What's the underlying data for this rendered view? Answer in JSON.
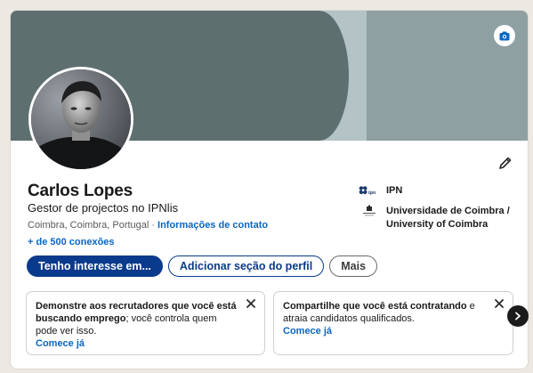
{
  "profile": {
    "name": "Carlos Lopes",
    "headline": "Gestor de projectos no IPNlis",
    "location": "Coimbra, Coimbra, Portugal",
    "separator": "·",
    "contact_link": "Informações de contato",
    "connections": "+ de 500 conexões"
  },
  "right_list": [
    {
      "logo": "ipn-logo",
      "label": "IPN"
    },
    {
      "logo": "university-coimbra-logo",
      "label": "Universidade de Coimbra / University of Coimbra"
    }
  ],
  "actions": {
    "primary": "Tenho interesse em...",
    "add_section": "Adicionar seção do perfil",
    "more": "Mais"
  },
  "tips": [
    {
      "bold_text": "Demonstre aos recrutadores que você está buscando emprego",
      "rest_text": "; você controla quem pode ver isso.",
      "link": "Comece já"
    },
    {
      "bold_text": "Compartilhe que você está contratando",
      "rest_text": " e atraia candidatos qualificados.",
      "link": "Comece já"
    }
  ],
  "icons": {
    "camera": "camera-icon",
    "edit": "pencil-icon",
    "close": "close-icon",
    "next": "chevron-right-icon"
  },
  "colors": {
    "link": "#0a66c2",
    "primary_button": "#0a3a8c",
    "banner_dark": "#5e6f70",
    "banner_light": "#b4c3c5",
    "banner_mid": "#8ea0a2"
  }
}
